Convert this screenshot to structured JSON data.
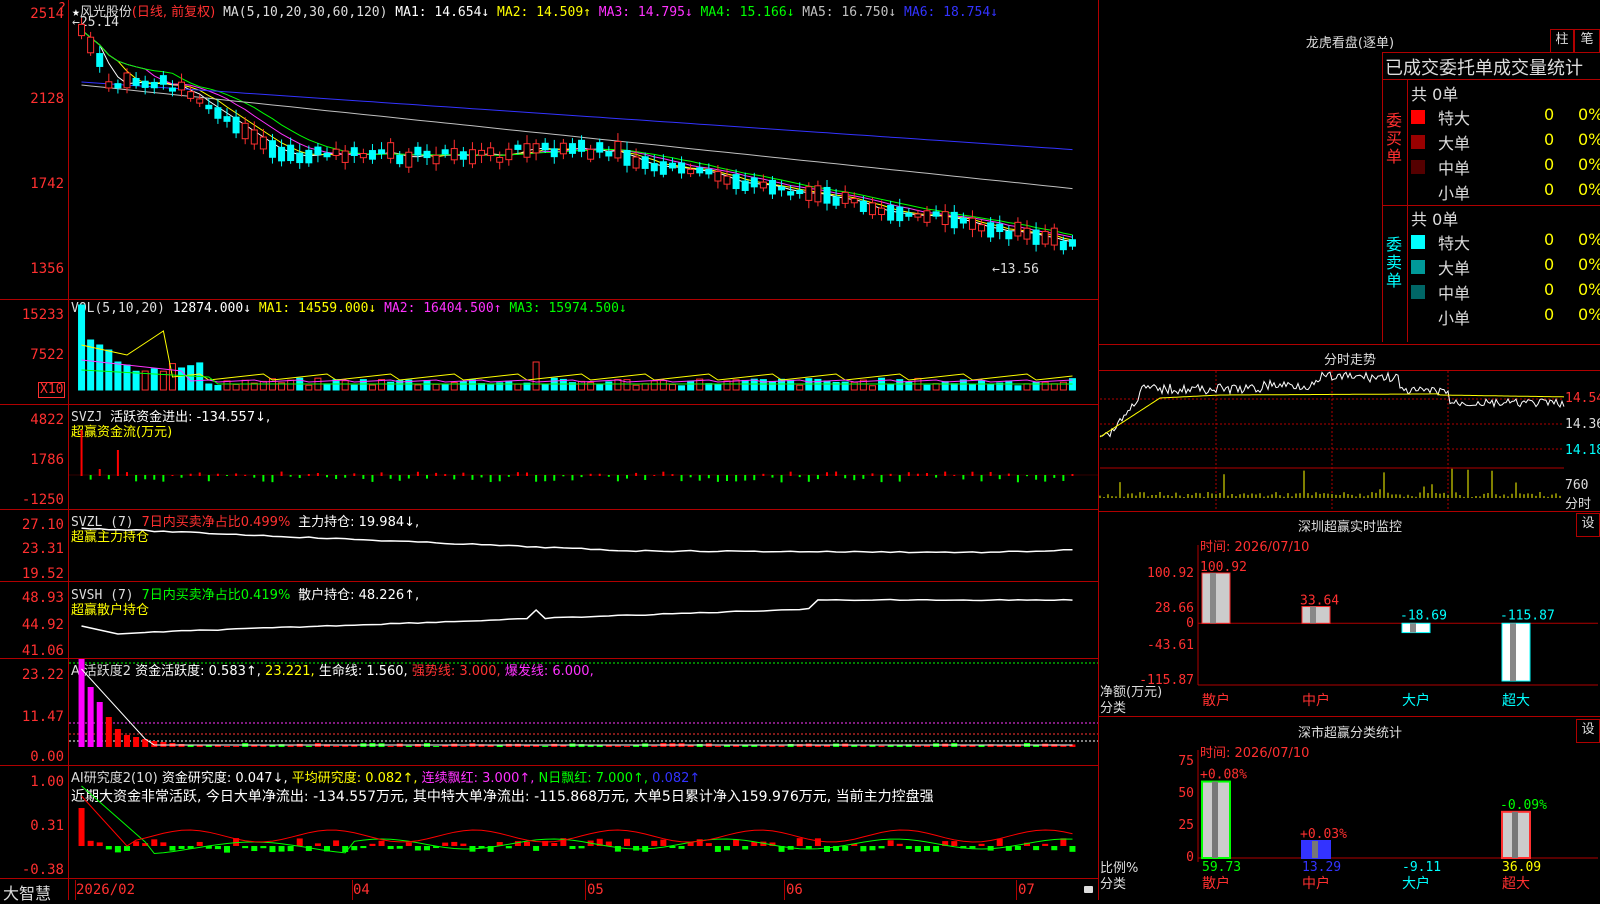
{
  "main": {
    "star": "★",
    "stock_name": "风光股份",
    "period": "(日线, 前复权)",
    "ma_prefix": "MA(5,10,20,30,60,120)",
    "ma": [
      {
        "label": "MA1: 14.654↓",
        "color": "#ffffff"
      },
      {
        "label": "MA2: 14.509↑",
        "color": "#ffff00"
      },
      {
        "label": "MA3: 14.795↓",
        "color": "#ff33ff"
      },
      {
        "label": "MA4: 15.166↓",
        "color": "#00ff00"
      },
      {
        "label": "MA5: 16.750↓",
        "color": "#c0c0c0"
      },
      {
        "label": "MA6: 18.754↓",
        "color": "#3333ff"
      }
    ],
    "high_mark": "←25.14",
    "low_mark": "←13.56",
    "yticks": [
      "2514",
      "2128",
      "1742",
      "1356"
    ]
  },
  "vol": {
    "header": "VOL(5,10,20)",
    "value": "12874.000↓",
    "ma": [
      {
        "label": "MA1: 14559.000↓",
        "color": "#ffff00"
      },
      {
        "label": "MA2: 16404.500↑",
        "color": "#ff33ff"
      },
      {
        "label": "MA3: 15974.500↓",
        "color": "#00ff00"
      }
    ],
    "yticks": [
      "15233",
      "7522"
    ],
    "unit": "X10"
  },
  "svzj": {
    "header": "SVZJ",
    "value": "活跃资金进出: -134.557↓,",
    "subtitle": "超赢资金流(万元)",
    "yticks": [
      "4822",
      "1786",
      "-1250"
    ]
  },
  "svzl": {
    "header": "SVZL (7)",
    "ratio": "7日内买卖净占比0.499%",
    "hold": "主力持仓: 19.984↓,",
    "subtitle": "超赢主力持仓",
    "yticks": [
      "27.10",
      "23.31",
      "19.52"
    ]
  },
  "svsh": {
    "header": "SVSH (7)",
    "ratio": "7日内买卖净占比0.419%",
    "hold": "散户持仓: 48.226↑,",
    "subtitle": "超赢散户持仓",
    "yticks": [
      "48.93",
      "44.92",
      "41.06"
    ]
  },
  "ai1": {
    "header": "AI活跃度2",
    "items": [
      {
        "label": "资金活跃度: 0.583↑,",
        "color": "#ffffff"
      },
      {
        "label": "23.221,",
        "color": "#ffff00"
      },
      {
        "label": "生命线: 1.560,",
        "color": "#ffffff"
      },
      {
        "label": "强势线: 3.000,",
        "color": "#ff3333"
      },
      {
        "label": "爆发线: 6.000,",
        "color": "#ff33ff"
      }
    ],
    "yticks": [
      "23.22",
      "11.47",
      "0.00"
    ]
  },
  "ai2": {
    "header": "AI研究度2(10)",
    "items": [
      {
        "label": "资金研究度: 0.047↓,",
        "color": "#ffffff"
      },
      {
        "label": "平均研究度: 0.082↑,",
        "color": "#ffff00"
      },
      {
        "label": "连续飘红: 3.000↑,",
        "color": "#ff33ff"
      },
      {
        "label": "N日飘红: 7.000↑,",
        "color": "#00ff00"
      },
      {
        "label": "0.082↑",
        "color": "#3333ff"
      }
    ],
    "commentary": "近期大资金非常活跃, 今日大单净流出: -134.557万元, 其中特大单净流出: -115.868万元, 大单5日累计净入159.976万元, 当前主力控盘强",
    "yticks": [
      "1.00",
      "0.31",
      "-0.38"
    ]
  },
  "xaxis": {
    "brand": "大智慧",
    "labels": [
      "2026/02",
      "04",
      "05",
      "06",
      "07"
    ]
  },
  "lhkp": {
    "title": "龙虎看盘(逐单)",
    "tab_zhu": "柱",
    "tab_bi": "笔",
    "subtitle": "已成交委托单成交量统计",
    "buy_label": "委买单",
    "sell_label": "委卖单",
    "buy_total": "共 0单",
    "sell_total": "共 0单",
    "buy_rows": [
      {
        "name": "特大",
        "count": "0",
        "pct": "0%",
        "color": "#ff0000"
      },
      {
        "name": "大单",
        "count": "0",
        "pct": "0%",
        "color": "#990000"
      },
      {
        "name": "中单",
        "count": "0",
        "pct": "0%",
        "color": "#550000"
      },
      {
        "name": "小单",
        "count": "0",
        "pct": "0%",
        "color": "#000000"
      }
    ],
    "sell_rows": [
      {
        "name": "特大",
        "count": "0",
        "pct": "0%",
        "color": "#00ffff"
      },
      {
        "name": "大单",
        "count": "0",
        "pct": "0%",
        "color": "#009999"
      },
      {
        "name": "中单",
        "count": "0",
        "pct": "0%",
        "color": "#006666"
      },
      {
        "name": "小单",
        "count": "0",
        "pct": "0%",
        "color": "#000000"
      }
    ]
  },
  "fszs": {
    "title": "分时走势",
    "yticks": [
      "14.54",
      "14.36",
      "14.18"
    ],
    "vol_tick": "760",
    "vol_unit": "分时"
  },
  "szcy": {
    "title": "深圳超赢实时监控",
    "settings": "设",
    "time": "时间: 2026/07/10",
    "yticks": [
      "100.92",
      "28.66",
      "0",
      "-43.61",
      "-115.87"
    ],
    "ylabel1": "净额(万元)",
    "ylabel2": "分类",
    "bars": [
      {
        "cat": "散户",
        "value": "100.92"
      },
      {
        "cat": "中户",
        "value": "33.64"
      },
      {
        "cat": "大户",
        "value": "-18.69"
      },
      {
        "cat": "超大",
        "value": "-115.87"
      }
    ]
  },
  "sscy": {
    "title": "深市超赢分类统计",
    "settings": "设",
    "time": "时间: 2026/07/10",
    "yticks": [
      "75",
      "50",
      "25",
      "0"
    ],
    "ylabel1": "比例%",
    "ylabel2": "分类",
    "bars": [
      {
        "cat": "散户",
        "top": "+0.08%",
        "bottom": "59.73"
      },
      {
        "cat": "中户",
        "top": "+0.03%",
        "bottom": "13.29"
      },
      {
        "cat": "大户",
        "top": "",
        "bottom": "-9.11"
      },
      {
        "cat": "超大",
        "top": "-0.09%",
        "bottom": "36.09"
      }
    ]
  }
}
